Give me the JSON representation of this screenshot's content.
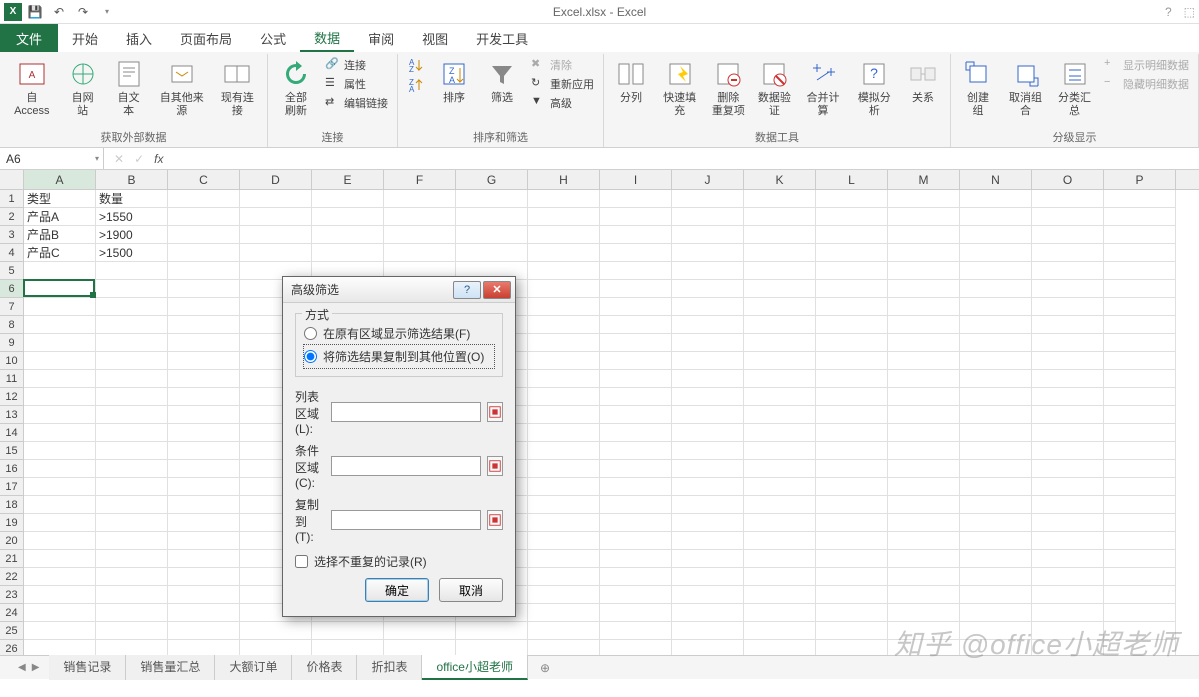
{
  "title": "Excel.xlsx - Excel",
  "tabs": {
    "file": "文件",
    "list": [
      "开始",
      "插入",
      "页面布局",
      "公式",
      "数据",
      "审阅",
      "视图",
      "开发工具"
    ],
    "active_index": 4
  },
  "ribbon": {
    "g1": {
      "label": "获取外部数据",
      "btns": [
        "自 Access",
        "自网站",
        "自文本",
        "自其他来源",
        "现有连接"
      ]
    },
    "g2": {
      "label": "连接",
      "refresh": "全部刷新",
      "items": [
        "连接",
        "属性",
        "编辑链接"
      ]
    },
    "g3": {
      "label": "排序和筛选",
      "sort": "排序",
      "filter": "筛选",
      "items": [
        "清除",
        "重新应用",
        "高级"
      ]
    },
    "g4": {
      "label": "数据工具",
      "btns": [
        "分列",
        "快速填充",
        "删除\n重复项",
        "数据验\n证",
        "合并计算",
        "模拟分析",
        "关系"
      ]
    },
    "g5": {
      "label": "分级显示",
      "btns": [
        "创建组",
        "取消组合",
        "分类汇总"
      ],
      "items": [
        "显示明细数据",
        "隐藏明细数据"
      ]
    }
  },
  "name_box": "A6",
  "columns": [
    "A",
    "B",
    "C",
    "D",
    "E",
    "F",
    "G",
    "H",
    "I",
    "J",
    "K",
    "L",
    "M",
    "N",
    "O",
    "P"
  ],
  "cells": {
    "A1": "类型",
    "B1": "数量",
    "A2": "产品A",
    "B2": ">1550",
    "A3": "产品B",
    "B3": ">1900",
    "A4": "产品C",
    "B4": ">1500"
  },
  "active": {
    "row": 6,
    "col": 0
  },
  "sheets": {
    "list": [
      "销售记录",
      "销售量汇总",
      "大额订单",
      "价格表",
      "折扣表",
      "office小超老师"
    ],
    "active_index": 5
  },
  "dialog": {
    "title": "高级筛选",
    "mode_label": "方式",
    "radio1": "在原有区域显示筛选结果(F)",
    "radio2": "将筛选结果复制到其他位置(O)",
    "list_range": "列表区域(L):",
    "criteria": "条件区域(C):",
    "copy_to": "复制到(T):",
    "unique": "选择不重复的记录(R)",
    "ok": "确定",
    "cancel": "取消",
    "values": {
      "list": "",
      "crit": "",
      "copy": ""
    }
  },
  "watermark": "知乎 @office小超老师"
}
